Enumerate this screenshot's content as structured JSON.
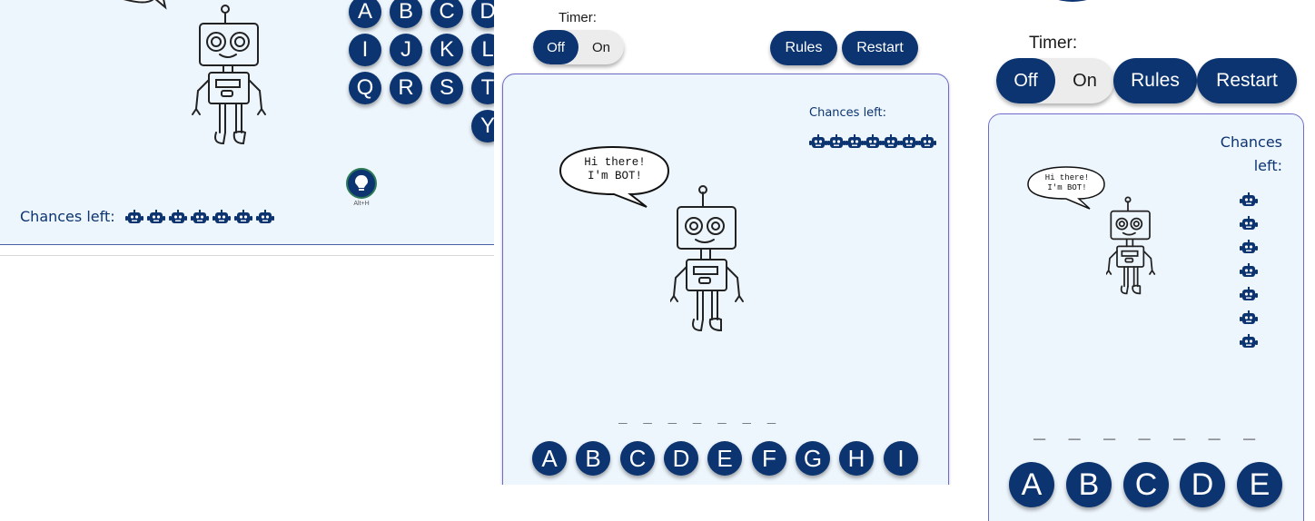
{
  "left_view": {
    "letters": [
      "A",
      "B",
      "C",
      "D",
      "I",
      "J",
      "K",
      "L",
      "Q",
      "R",
      "S",
      "T",
      "Y"
    ],
    "hint_key_label": "Alt+H",
    "chances_label": "Chances left:",
    "chances_count": 7
  },
  "middle_view": {
    "timer_label": "Timer:",
    "timer_options": [
      "Off",
      "On"
    ],
    "timer_selected": "Off",
    "rules_label": "Rules",
    "restart_label": "Restart",
    "chances_label": "Chances left:",
    "chances_count": 7,
    "bubble_line1": "Hi there!",
    "bubble_line2": "I'm BOT!",
    "word_blanks": "_ _ _ _ _ _ _",
    "letters": [
      "A",
      "B",
      "C",
      "D",
      "E",
      "F",
      "G",
      "H",
      "I"
    ]
  },
  "right_view": {
    "timer_label": "Timer:",
    "timer_options": [
      "Off",
      "On"
    ],
    "timer_selected": "Off",
    "rules_label": "Rules",
    "restart_label": "Restart",
    "chances_label": "Chances left:",
    "chances_count": 7,
    "bubble_line1": "Hi there!",
    "bubble_line2": "I'm BOT!",
    "word_blanks": "_ _ _ _ _ _ _",
    "letters": [
      "A",
      "B",
      "C",
      "D",
      "E"
    ]
  },
  "colors": {
    "primary": "#0b3470",
    "card_bg": "#eef6fd",
    "card_border": "#6f6bc9",
    "toggle_bg": "#ececec"
  },
  "icons": {
    "chance": "robot-head-icon",
    "hint": "lightbulb-icon",
    "mascot": "robot-mascot"
  }
}
